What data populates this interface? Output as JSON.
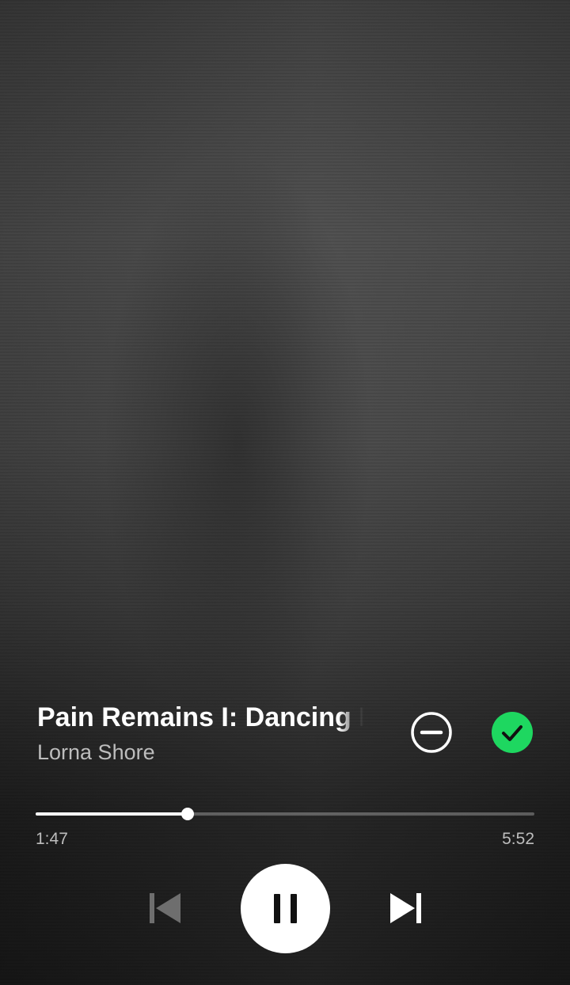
{
  "track": {
    "title": "Pain Remains I: Dancing Like Flames",
    "artist": "Lorna Shore"
  },
  "playback": {
    "elapsed": "1:47",
    "total": "5:52",
    "progress_fraction": 0.305,
    "state": "playing"
  },
  "actions": {
    "remove_icon": "minus-circle-icon",
    "added_icon": "check-circle-icon",
    "added_color": "#1ed760"
  },
  "controls": {
    "previous_icon": "skip-previous-icon",
    "pause_icon": "pause-icon",
    "next_icon": "skip-next-icon"
  }
}
